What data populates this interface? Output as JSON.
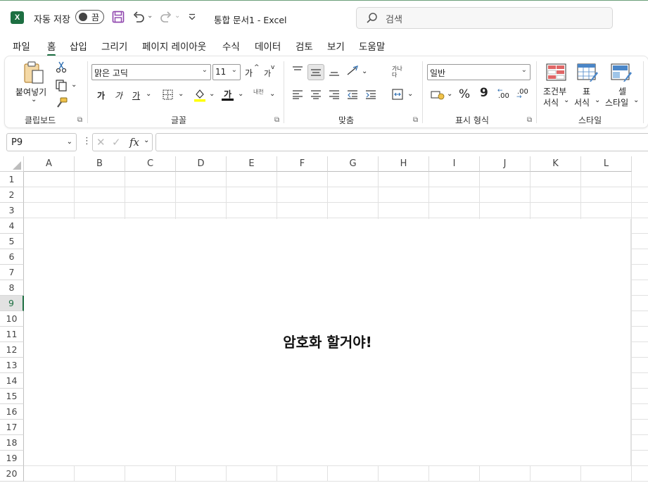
{
  "titlebar": {
    "autosave_label": "자동 저장",
    "autosave_state": "끔",
    "document_title": "통합 문서1  -  Excel",
    "search_placeholder": "검색",
    "app_icon": "excel-icon"
  },
  "menu_tabs": [
    "파일",
    "홈",
    "삽입",
    "그리기",
    "페이지 레이아웃",
    "수식",
    "데이터",
    "검토",
    "보기",
    "도움말"
  ],
  "active_tab": "홈",
  "ribbon": {
    "clipboard": {
      "paste_label": "붙여넣기",
      "group_label": "클립보드"
    },
    "font": {
      "font_name": "맑은 고딕",
      "font_size": "11",
      "increase_size": "가",
      "decrease_size": "가",
      "bold": "가",
      "italic": "가",
      "underline": "가",
      "font_color_glyph": "가",
      "phonetic": "내천",
      "group_label": "글꼴"
    },
    "alignment": {
      "wrap_glyph": "가나다",
      "group_label": "맞춤"
    },
    "number": {
      "format": "일반",
      "percent": "%",
      "comma": "9",
      "dec_increase": ".00",
      "dec_decrease": ".00",
      "group_label": "표시 형식"
    },
    "styles": {
      "conditional_l1": "조건부",
      "conditional_l2": "서식",
      "table_l1": "표",
      "table_l2": "서식",
      "cell_l1": "셀",
      "cell_l2": "스타일",
      "group_label": "스타일"
    }
  },
  "formula_bar": {
    "name_box": "P9",
    "fx": "fx",
    "formula": ""
  },
  "sheet": {
    "columns": [
      "A",
      "B",
      "C",
      "D",
      "E",
      "F",
      "G",
      "H",
      "I",
      "J",
      "K",
      "L"
    ],
    "rows": [
      "1",
      "2",
      "3",
      "4",
      "5",
      "6",
      "7",
      "8",
      "9",
      "10",
      "11",
      "12",
      "13",
      "14",
      "15",
      "16",
      "17",
      "18",
      "19",
      "20"
    ],
    "active_row": "9",
    "merged_cell_text": "암호화 할거야!"
  },
  "colors": {
    "accent": "#1d6f42",
    "selected_row_bg": "#e2e2e2"
  }
}
